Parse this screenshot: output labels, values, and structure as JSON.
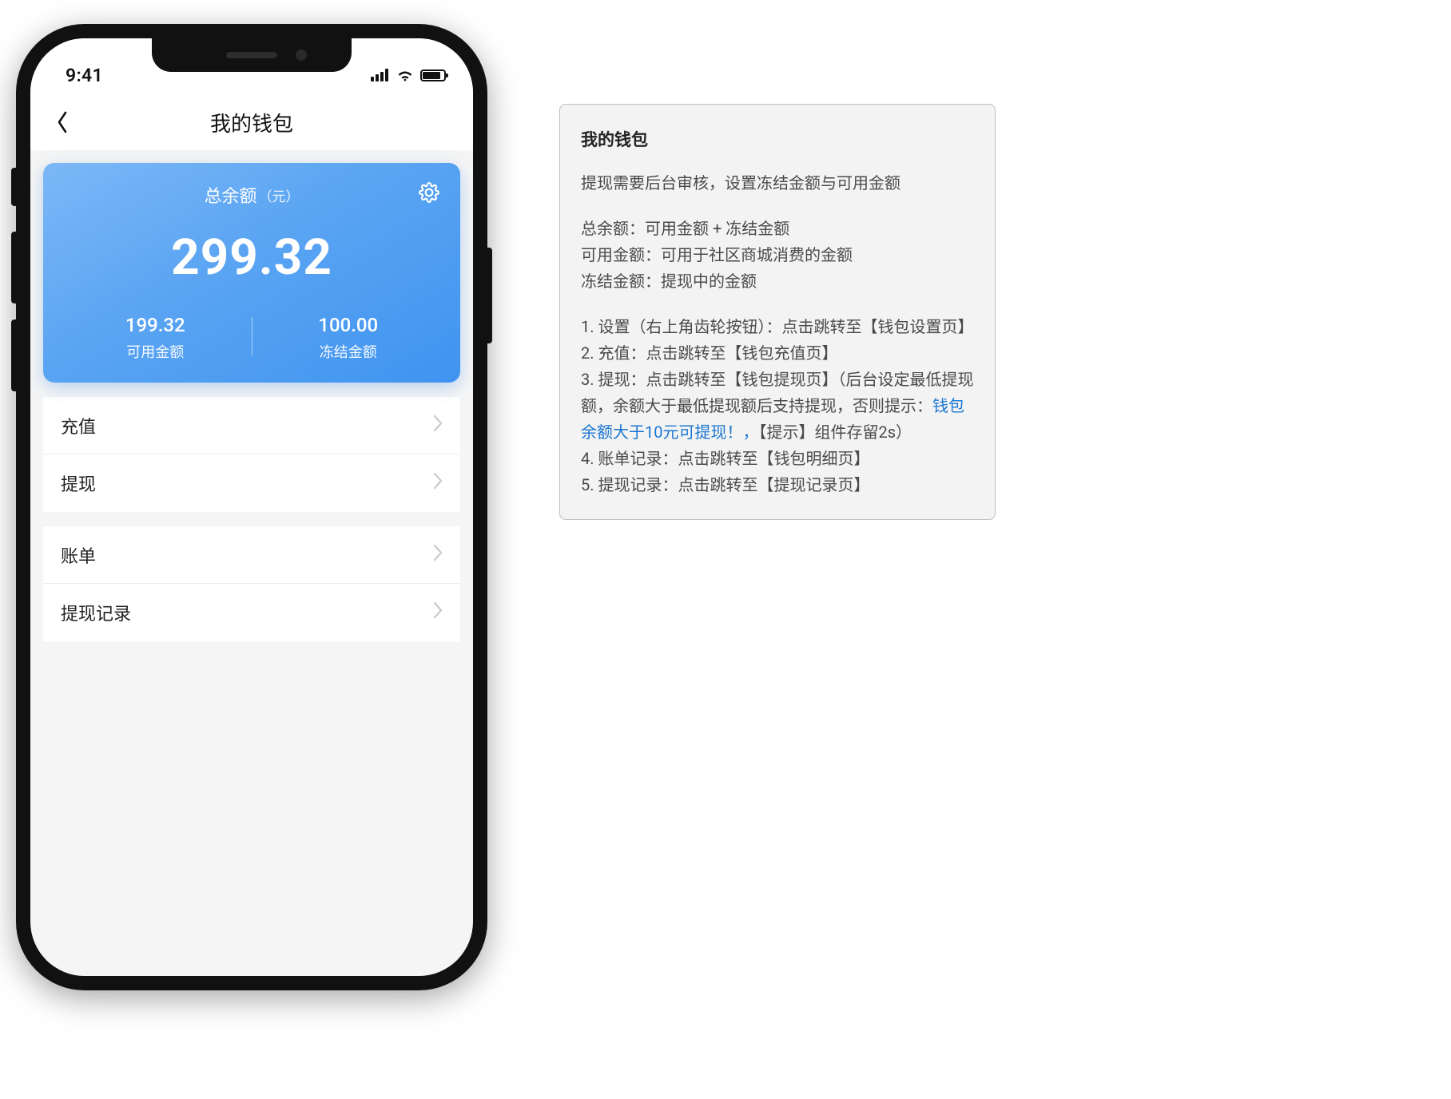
{
  "status": {
    "time": "9:41"
  },
  "nav": {
    "title": "我的钱包"
  },
  "card": {
    "label": "总余额",
    "unit": "（元）",
    "amount": "299.32",
    "available": {
      "value": "199.32",
      "label": "可用金额"
    },
    "frozen": {
      "value": "100.00",
      "label": "冻结金额"
    }
  },
  "menu": {
    "group1": [
      {
        "label": "充值"
      },
      {
        "label": "提现"
      }
    ],
    "group2": [
      {
        "label": "账单"
      },
      {
        "label": "提现记录"
      }
    ]
  },
  "note": {
    "title": "我的钱包",
    "intro": "提现需要后台审核，设置冻结金额与可用金额",
    "defs": [
      "总余额：可用金额 + 冻结金额",
      "可用金额：可用于社区商城消费的金额",
      "冻结金额：提现中的金额"
    ],
    "steps": {
      "s1": "1. 设置（右上角齿轮按钮）：点击跳转至【钱包设置页】",
      "s2": "2. 充值：点击跳转至【钱包充值页】",
      "s3a": "3. 提现：点击跳转至【钱包提现页】（后台设定最低提现额，余额大于最低提现额后支持提现，否则提示：",
      "s3link": "钱包余额大于10元可提现！，",
      "s3b": "【提示】组件存留2s）",
      "s4": "4. 账单记录：点击跳转至【钱包明细页】",
      "s5": "5. 提现记录：点击跳转至【提现记录页】"
    }
  }
}
